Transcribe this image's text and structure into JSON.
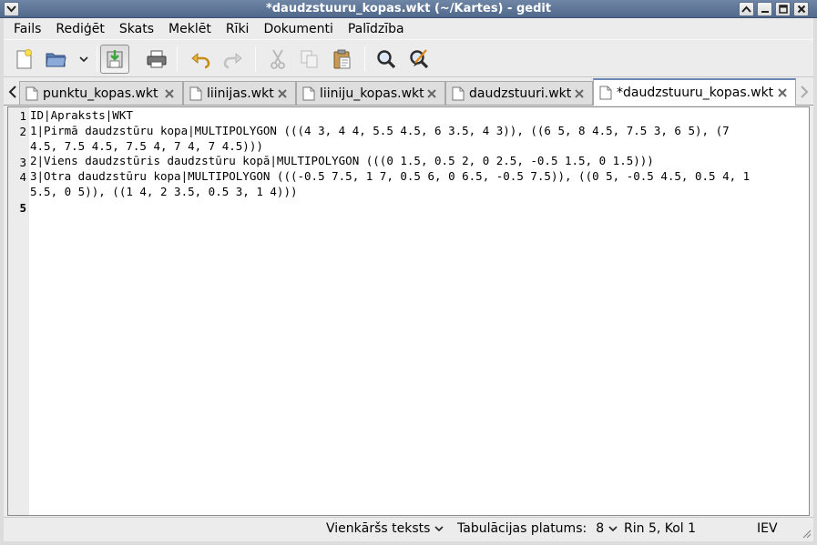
{
  "window": {
    "title": "*daudzstuuru_kopas.wkt (~/Kartes) - gedit",
    "controls": [
      "window-menu-icon",
      "shade-up-icon",
      "minimize-icon",
      "maximize-icon",
      "close-icon"
    ]
  },
  "menubar": {
    "items": [
      "Fails",
      "Rediģēt",
      "Skats",
      "Meklēt",
      "Rīki",
      "Dokumenti",
      "Palīdzība"
    ]
  },
  "toolbar": {
    "icons": [
      "new-document-icon",
      "open-folder-icon",
      "open-recent-dropdown-icon",
      "save-icon",
      "print-icon",
      "undo-icon",
      "redo-icon",
      "cut-icon",
      "copy-icon",
      "paste-icon",
      "find-icon",
      "find-replace-icon"
    ]
  },
  "tabs": {
    "items": [
      {
        "label": "punktu_kopas.wkt",
        "active": false
      },
      {
        "label": "liinijas.wkt",
        "active": false
      },
      {
        "label": "liiniju_kopas.wkt",
        "active": false
      },
      {
        "label": "daudzstuuri.wkt",
        "active": false
      },
      {
        "label": "*daudzstuuru_kopas.wkt",
        "active": true
      }
    ]
  },
  "editor": {
    "line_numbers": [
      "1",
      "2",
      "3",
      "4",
      "5"
    ],
    "current_line": "5",
    "visual_lines": [
      "ID|Apraksts|WKT",
      "1|Pirmā daudzstūru kopa|MULTIPOLYGON (((4 3, 4 4, 5.5 4.5, 6 3.5, 4 3)), ((6 5, 8 4.5, 7.5 3, 6 5), (7",
      "4.5, 7.5 4.5, 7.5 4, 7 4, 7 4.5)))",
      "2|Viens daudzstūris daudzstūru kopā|MULTIPOLYGON (((0 1.5, 0.5 2, 0 2.5, -0.5 1.5, 0 1.5)))",
      "3|Otra daudzstūru kopa|MULTIPOLYGON (((-0.5 7.5, 1 7, 0.5 6, 0 6.5, -0.5 7.5)), ((0 5, -0.5 4.5, 0.5 4, 1",
      "5.5, 0 5)), ((1 4, 2 3.5, 0.5 3, 1 4)))",
      ""
    ]
  },
  "statusbar": {
    "language": "Vienkāršs teksts",
    "tab_width_label": "Tabulācijas platums:",
    "tab_width_value": "8",
    "position": "Rin 5, Kol 1",
    "mode": "IEV"
  },
  "colors": {
    "titlebar": "#5a7196",
    "active_tab_accent": "#6a87b5",
    "gutter": "#ececec"
  }
}
